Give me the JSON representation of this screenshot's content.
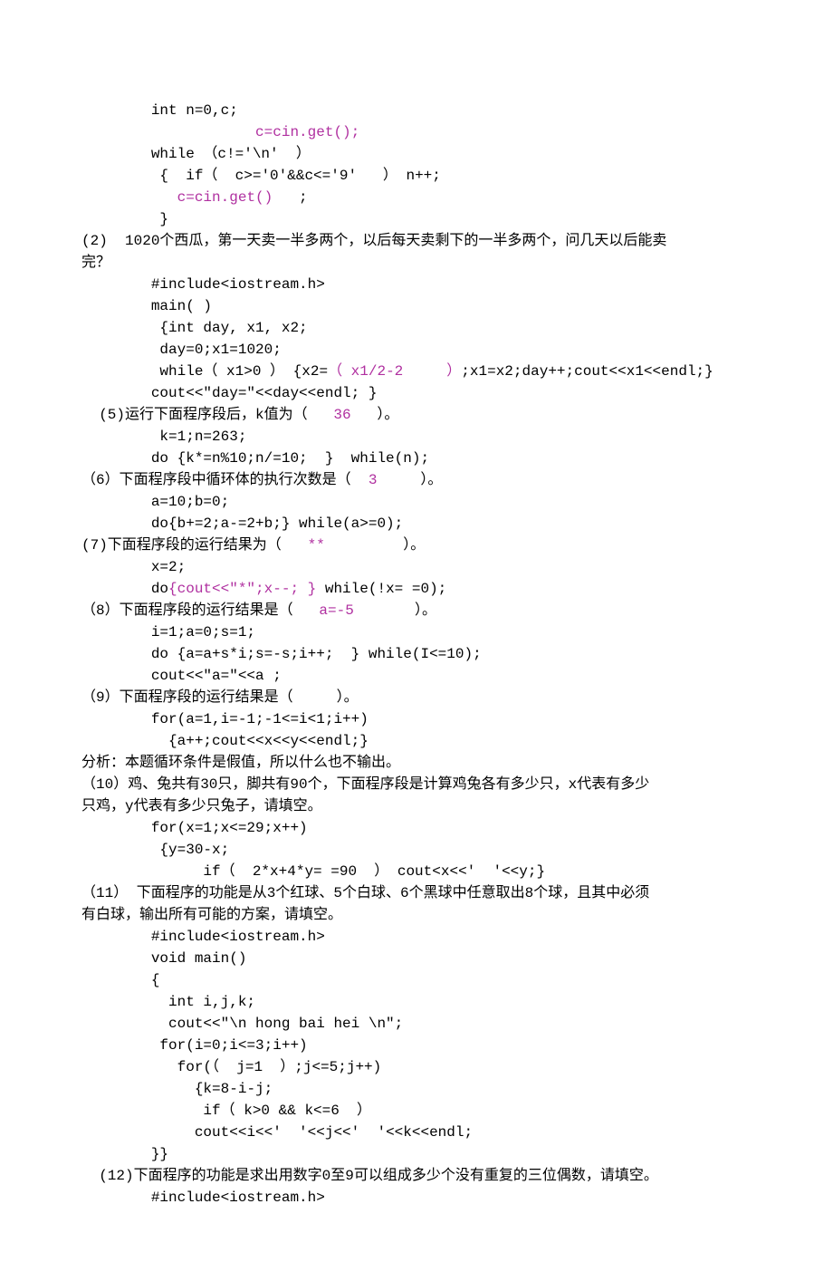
{
  "lines": [
    {
      "indent": "        ",
      "segs": [
        {
          "t": "int n=0,c;"
        }
      ]
    },
    {
      "indent": "                    ",
      "segs": [
        {
          "t": "c=cin.get();",
          "hl": true
        }
      ]
    },
    {
      "indent": "        ",
      "segs": [
        {
          "t": "while （c!='\\n'  ）"
        }
      ]
    },
    {
      "indent": "         ",
      "segs": [
        {
          "t": "{  if（  c>='0'&&c<='9'   ） n++;"
        }
      ]
    },
    {
      "indent": "           ",
      "segs": [
        {
          "t": "c=cin.get()   ",
          "hl": true
        },
        {
          "t": ";"
        }
      ]
    },
    {
      "indent": "         ",
      "segs": [
        {
          "t": "}"
        }
      ]
    },
    {
      "indent": "",
      "segs": [
        {
          "t": "(2)  1020个西瓜，第一天卖一半多两个，以后每天卖剩下的一半多两个，问几天以后能卖"
        }
      ]
    },
    {
      "indent": "",
      "segs": [
        {
          "t": "完？"
        }
      ]
    },
    {
      "indent": "        ",
      "segs": [
        {
          "t": "#include<iostream.h>"
        }
      ]
    },
    {
      "indent": "        ",
      "segs": [
        {
          "t": "main( )"
        }
      ]
    },
    {
      "indent": "        ",
      "segs": [
        {
          "t": " {int day, x1, x2;"
        }
      ]
    },
    {
      "indent": "         ",
      "segs": [
        {
          "t": "day=0;x1=1020;"
        }
      ]
    },
    {
      "indent": "         ",
      "segs": [
        {
          "t": "while（ x1>0 ） {x2="
        },
        {
          "t": "（ x1/2-2     ）",
          "hl": true
        },
        {
          "t": ";x1=x2;day++;cout<<x1<<endl;}"
        }
      ]
    },
    {
      "indent": "        ",
      "segs": [
        {
          "t": "cout<<\"day=\"<<day<<endl; }"
        }
      ]
    },
    {
      "indent": "  ",
      "segs": [
        {
          "t": "(5)运行下面程序段后，k值为（   "
        },
        {
          "t": "36",
          "hl": true
        },
        {
          "t": "   ）。"
        }
      ]
    },
    {
      "indent": "         ",
      "segs": [
        {
          "t": "k=1;n=263;"
        }
      ]
    },
    {
      "indent": "        ",
      "segs": [
        {
          "t": "do {k*=n%10;n/=10;  }  while(n);"
        }
      ]
    },
    {
      "indent": "",
      "segs": [
        {
          "t": "（6）下面程序段中循环体的执行次数是（  "
        },
        {
          "t": "3",
          "hl": true
        },
        {
          "t": "     ）。"
        }
      ]
    },
    {
      "indent": "        ",
      "segs": [
        {
          "t": "a=10;b=0;"
        }
      ]
    },
    {
      "indent": "        ",
      "segs": [
        {
          "t": "do{b+=2;a-=2+b;} while(a>=0);"
        }
      ]
    },
    {
      "indent": "",
      "segs": [
        {
          "t": "(7)下面程序段的运行结果为（   "
        },
        {
          "t": "**",
          "hl": true
        },
        {
          "t": "         ）。"
        }
      ]
    },
    {
      "indent": "        ",
      "segs": [
        {
          "t": "x=2;"
        }
      ]
    },
    {
      "indent": "        ",
      "segs": [
        {
          "t": "do"
        },
        {
          "t": "{cout<<\"*\";x--; }",
          "hl": true
        },
        {
          "t": " while(!x= =0);"
        }
      ]
    },
    {
      "indent": "",
      "segs": [
        {
          "t": "（8）下面程序段的运行结果是（   "
        },
        {
          "t": "a=-5",
          "hl": true
        },
        {
          "t": "       ）。"
        }
      ]
    },
    {
      "indent": "        ",
      "segs": [
        {
          "t": "i=1;a=0;s=1;"
        }
      ]
    },
    {
      "indent": "        ",
      "segs": [
        {
          "t": "do {a=a+s*i;s=-s;i++;  } while(I<=10);"
        }
      ]
    },
    {
      "indent": "        ",
      "segs": [
        {
          "t": "cout<<\"a=\"<<a ;"
        }
      ]
    },
    {
      "indent": "",
      "segs": [
        {
          "t": "（9）下面程序段的运行结果是（     ）。"
        }
      ]
    },
    {
      "indent": "        ",
      "segs": [
        {
          "t": "for(a=1,i=-1;-1<=i<1;i++)"
        }
      ]
    },
    {
      "indent": "          ",
      "segs": [
        {
          "t": "{a++;cout<<x<<y<<endl;}"
        }
      ]
    },
    {
      "indent": "",
      "segs": [
        {
          "t": "分析：本题循环条件是假值，所以什么也不输出。"
        }
      ]
    },
    {
      "indent": "",
      "segs": [
        {
          "t": "（10）鸡、兔共有30只，脚共有90个，下面程序段是计算鸡兔各有多少只，x代表有多少"
        }
      ]
    },
    {
      "indent": "",
      "segs": [
        {
          "t": "只鸡，y代表有多少只兔子，请填空。"
        }
      ]
    },
    {
      "indent": "        ",
      "segs": [
        {
          "t": "for(x=1;x<=29;x++)"
        }
      ]
    },
    {
      "indent": "        ",
      "segs": [
        {
          "t": " {y=30-x;"
        }
      ]
    },
    {
      "indent": "              ",
      "segs": [
        {
          "t": "if（  2*x+4*y= =90  ） cout<x<<'  '<<y;}"
        }
      ]
    },
    {
      "indent": "",
      "segs": [
        {
          "t": "（11） 下面程序的功能是从3个红球、5个白球、6个黑球中任意取出8个球，且其中必须"
        }
      ]
    },
    {
      "indent": "",
      "segs": [
        {
          "t": "有白球，输出所有可能的方案，请填空。"
        }
      ]
    },
    {
      "indent": "        ",
      "segs": [
        {
          "t": "#include<iostream.h>"
        }
      ]
    },
    {
      "indent": "        ",
      "segs": [
        {
          "t": "void main()"
        }
      ]
    },
    {
      "indent": "        ",
      "segs": [
        {
          "t": "{"
        }
      ]
    },
    {
      "indent": "          ",
      "segs": [
        {
          "t": "int i,j,k;"
        }
      ]
    },
    {
      "indent": "          ",
      "segs": [
        {
          "t": "cout<<\"\\n hong bai hei \\n\";"
        }
      ]
    },
    {
      "indent": "         ",
      "segs": [
        {
          "t": "for(i=0;i<=3;i++)"
        }
      ]
    },
    {
      "indent": "           ",
      "segs": [
        {
          "t": "for(（  j=1  ）;j<=5;j++)"
        }
      ]
    },
    {
      "indent": "             ",
      "segs": [
        {
          "t": "{k=8-i-j;"
        }
      ]
    },
    {
      "indent": "              ",
      "segs": [
        {
          "t": "if（ k>0 && k<=6  ）"
        }
      ]
    },
    {
      "indent": "             ",
      "segs": [
        {
          "t": "cout<<i<<'  '<<j<<'  '<<k<<endl;"
        }
      ]
    },
    {
      "indent": "        ",
      "segs": [
        {
          "t": "}}"
        }
      ]
    },
    {
      "indent": "  ",
      "segs": [
        {
          "t": "(12)下面程序的功能是求出用数字0至9可以组成多少个没有重复的三位偶数，请填空。"
        }
      ]
    },
    {
      "indent": "        ",
      "segs": [
        {
          "t": "#include<iostream.h>"
        }
      ]
    }
  ]
}
